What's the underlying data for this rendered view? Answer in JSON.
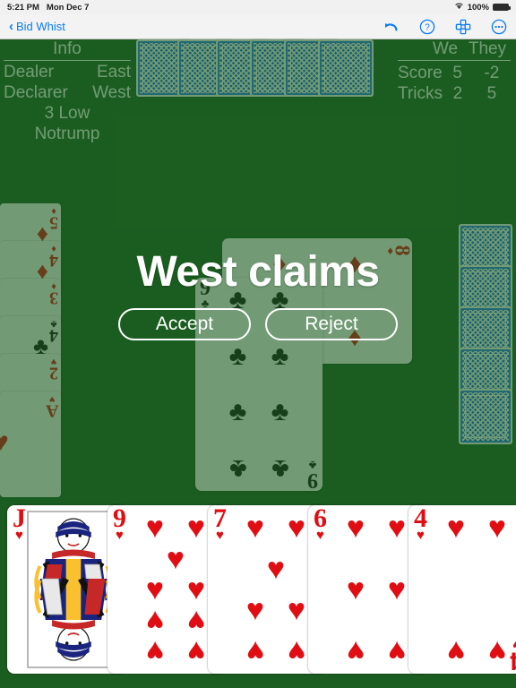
{
  "statusbar": {
    "time": "5:21 PM",
    "date": "Mon Dec 7",
    "wifi_icon": "wifi-icon",
    "battery_percent": "100%"
  },
  "navbar": {
    "back_label": "Bid Whist",
    "back_chevron": "‹",
    "icons": [
      {
        "name": "undo-icon",
        "label": "Undo"
      },
      {
        "name": "help-icon",
        "label": "Help"
      },
      {
        "name": "layout-icon",
        "label": "Layout"
      },
      {
        "name": "more-icon",
        "label": "More"
      }
    ]
  },
  "info_panel": {
    "title": "Info",
    "rows": [
      {
        "label": "Dealer",
        "value": "East"
      },
      {
        "label": "Declarer",
        "value": "West"
      }
    ],
    "contract_line1": "3 Low",
    "contract_line2": "Notrump"
  },
  "score_panel": {
    "col_we": "We",
    "col_they": "They",
    "rows": [
      {
        "label": "Score",
        "we": "5",
        "they": "-2"
      },
      {
        "label": "Tricks",
        "we": "2",
        "they": "5"
      }
    ]
  },
  "claim_dialog": {
    "title": "West claims",
    "accept_label": "Accept",
    "reject_label": "Reject"
  },
  "hands": {
    "north": {
      "count": 6,
      "face": "down"
    },
    "east": {
      "count": 5,
      "face": "down"
    },
    "west": {
      "face": "up",
      "cards": [
        {
          "rank": "5",
          "suit": "♦",
          "color": "red"
        },
        {
          "rank": "4",
          "suit": "♦",
          "color": "red"
        },
        {
          "rank": "3",
          "suit": "♦",
          "color": "red"
        },
        {
          "rank": "4",
          "suit": "♣",
          "color": "black"
        },
        {
          "rank": "2",
          "suit": "♥",
          "color": "red"
        },
        {
          "rank": "A",
          "suit": "♥",
          "color": "red"
        }
      ]
    },
    "south": {
      "face": "up",
      "cards": [
        {
          "rank": "J",
          "suit": "♥",
          "color": "red",
          "court": true
        },
        {
          "rank": "9",
          "suit": "♥",
          "color": "red",
          "court": false
        },
        {
          "rank": "7",
          "suit": "♥",
          "color": "red",
          "court": false
        },
        {
          "rank": "6",
          "suit": "♥",
          "color": "red",
          "court": false
        },
        {
          "rank": "4",
          "suit": "♥",
          "color": "red",
          "court": false
        }
      ]
    }
  },
  "trick": {
    "cards": [
      {
        "rank": "9",
        "suit": "♣",
        "color": "black",
        "position": "center"
      },
      {
        "rank": "8",
        "suit": "♦",
        "color": "red",
        "position": "right-rotated"
      }
    ]
  },
  "colors": {
    "felt_green": "#1b5e20",
    "card_back_blue": "#1565f0",
    "accent_blue": "#0a7cf5",
    "red_suit": "#e00d12",
    "black_suit": "#111111",
    "white": "#ffffff"
  }
}
